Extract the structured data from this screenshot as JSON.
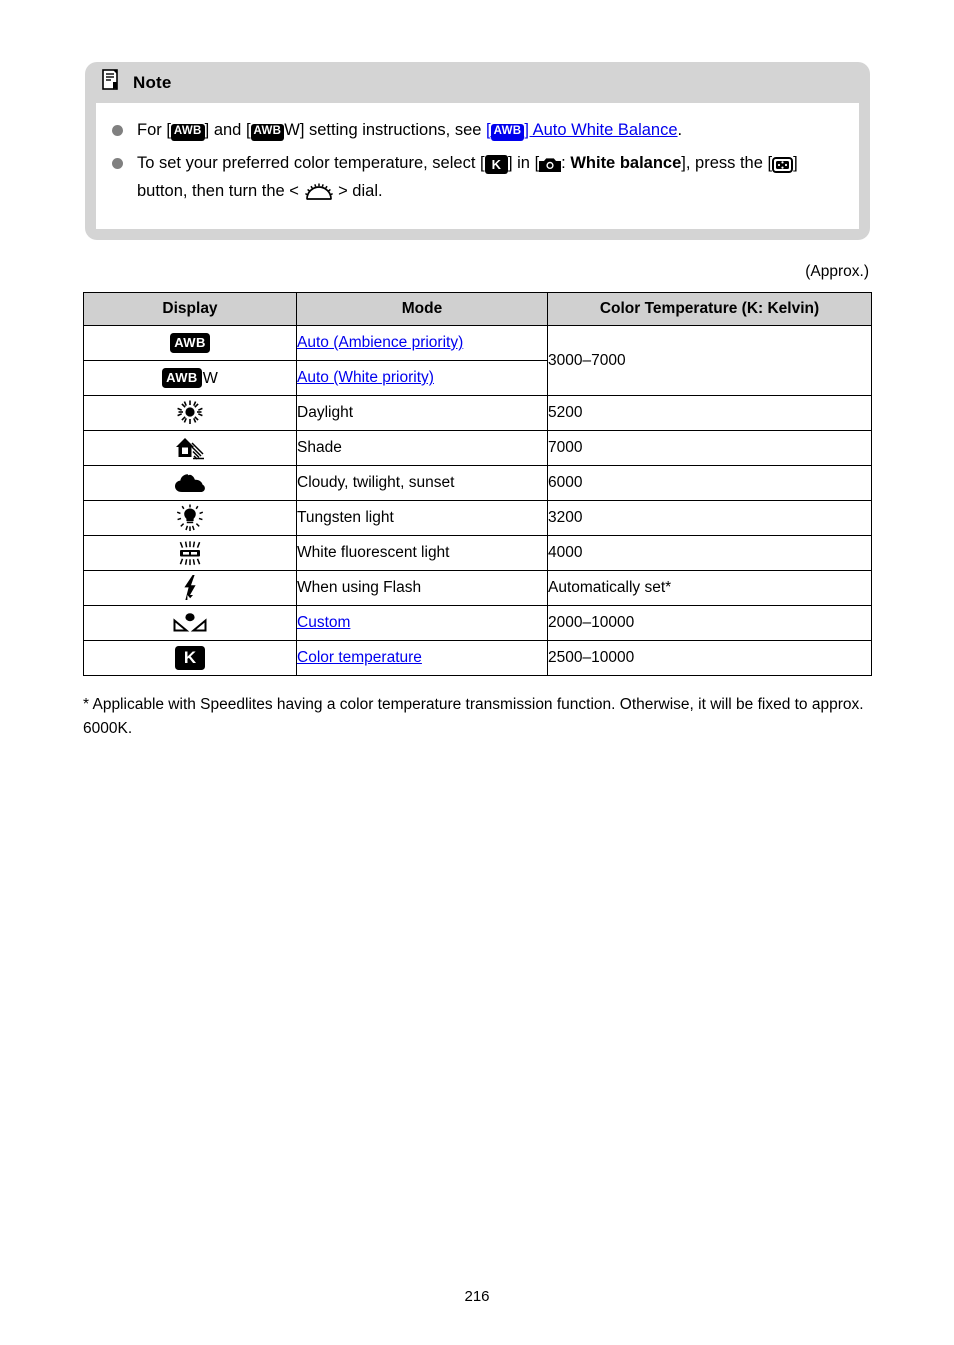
{
  "note": {
    "icon": "note-memo-icon",
    "title": "Note",
    "bullets": [
      {
        "id": "bullet-awb-setting-instructions",
        "parts": [
          {
            "type": "text",
            "value": "For ["
          },
          {
            "type": "awb-chip",
            "value": "AWB"
          },
          {
            "type": "text",
            "value": "] and ["
          },
          {
            "type": "awb-chip",
            "value": "AWB"
          },
          {
            "type": "text",
            "value": "W] setting instructions, see "
          },
          {
            "type": "link-open",
            "value": "["
          },
          {
            "type": "awb-chip-blue",
            "value": "AWB"
          },
          {
            "type": "link-close",
            "value": "] Auto White Balance"
          },
          {
            "type": "text",
            "value": "."
          }
        ],
        "link_label": "[AWB] Auto White Balance",
        "link_color": "#0000ee"
      },
      {
        "id": "bullet-preferred-color-temperature",
        "parts": [
          {
            "type": "text",
            "value": "To set your preferred color temperature, select ["
          },
          {
            "type": "k-chip",
            "value": "K"
          },
          {
            "type": "text",
            "value": "] in ["
          },
          {
            "type": "camera-icon",
            "value": ""
          },
          {
            "type": "text",
            "value": ": "
          },
          {
            "type": "bold",
            "value": "White balance"
          },
          {
            "type": "text",
            "value": "], press the ["
          },
          {
            "type": "button-icon",
            "value": ""
          },
          {
            "type": "text",
            "value": "] button, then turn the < "
          },
          {
            "type": "dial-icon",
            "value": ""
          },
          {
            "type": "text",
            "value": " > dial."
          }
        ]
      }
    ]
  },
  "approx_label": "(Approx.)",
  "table": {
    "headers": [
      "Display",
      "Mode",
      "Color Temperature (K: Kelvin)"
    ],
    "rows": [
      {
        "display_icon": "awb-chip-icon",
        "display_text": "AWB",
        "display_suffix": "",
        "mode": "Auto (Ambience priority)",
        "mode_is_link": true,
        "temperature": "3000–7000",
        "temperature_rowspan": 2
      },
      {
        "display_icon": "awb-w-chip-icon",
        "display_text": "AWB",
        "display_suffix": "W",
        "mode": "Auto (White priority)",
        "mode_is_link": true,
        "temperature": null
      },
      {
        "display_icon": "daylight-sun-icon",
        "mode": "Daylight",
        "mode_is_link": false,
        "temperature": "5200"
      },
      {
        "display_icon": "shade-house-icon",
        "mode": "Shade",
        "mode_is_link": false,
        "temperature": "7000"
      },
      {
        "display_icon": "cloud-icon",
        "mode": "Cloudy, twilight, sunset",
        "mode_is_link": false,
        "temperature": "6000"
      },
      {
        "display_icon": "tungsten-bulb-icon",
        "mode": "Tungsten light",
        "mode_is_link": false,
        "temperature": "3200"
      },
      {
        "display_icon": "fluorescent-tube-icon",
        "mode": "White fluorescent light",
        "mode_is_link": false,
        "temperature": "4000"
      },
      {
        "display_icon": "flash-bolt-icon",
        "mode": "When using Flash",
        "mode_is_link": false,
        "temperature": "Automatically set*"
      },
      {
        "display_icon": "custom-wb-icon",
        "mode": "Custom",
        "mode_is_link": true,
        "temperature": "2000–10000"
      },
      {
        "display_icon": "kelvin-k-icon",
        "display_text": "K",
        "mode": "Color temperature",
        "mode_is_link": true,
        "temperature": "2500–10000"
      }
    ]
  },
  "footnote": " * Applicable with Speedlites having a color temperature transmission function. Otherwise, it will be fixed to approx. 6000K.",
  "page_number": "216",
  "colors": {
    "link": "#0000ee",
    "note_box": "#d4d4d4",
    "table_header": "#d0d0d0",
    "bullet_dot": "#808080",
    "text": "#000000"
  }
}
